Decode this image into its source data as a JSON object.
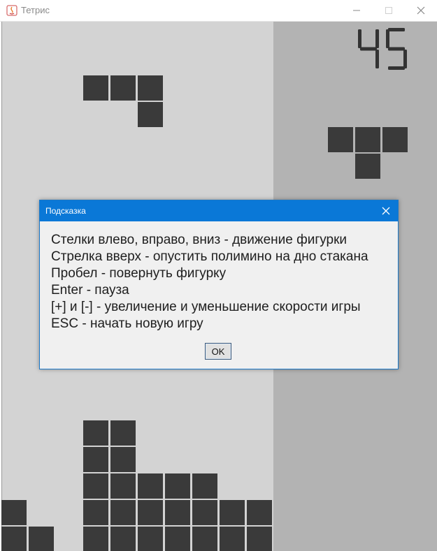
{
  "window": {
    "title": "Тетрис",
    "controls": [
      "minimize-icon",
      "maximize-icon",
      "close-icon"
    ]
  },
  "game": {
    "score": "45",
    "piece_color": "#3a3a3a",
    "board_color": "#d3d3d3",
    "side_panel_color": "#b3b3b3"
  },
  "dialog": {
    "title": "Подсказка",
    "lines": [
      "Стелки влево, вправо, вниз - движение фигурки",
      "Стрелка вверх - опустить полимино на дно стакана",
      "Пробел - повернуть фигурку",
      "Enter - пауза",
      "[+] и [-] - увеличение и уменьшение скорости игры",
      "ESC - начать новую игру"
    ],
    "ok_label": "OK",
    "accent": "#0a78d7"
  }
}
